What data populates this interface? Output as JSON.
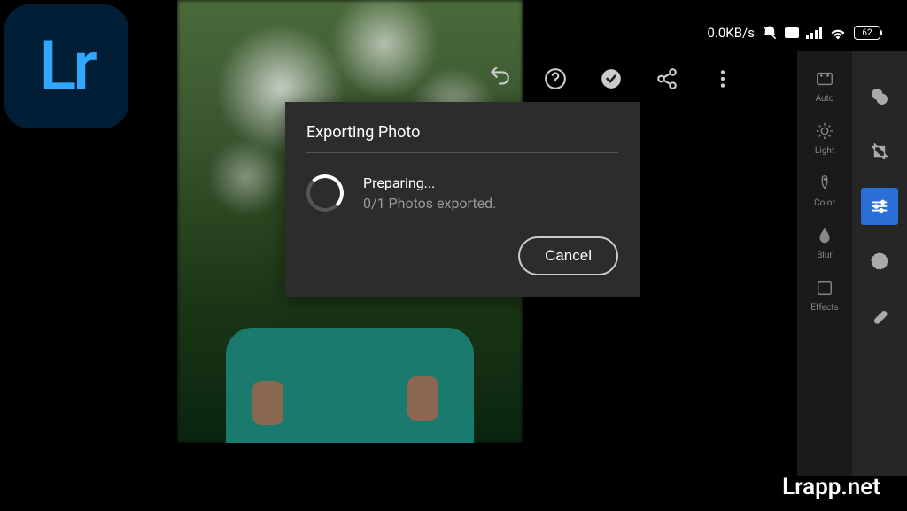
{
  "app_icon": "Lr",
  "status_bar": {
    "network_speed": "0.0KB/s",
    "battery": "62"
  },
  "toolbar": {
    "undo": "undo",
    "help": "help",
    "done": "done",
    "share": "share",
    "more": "more"
  },
  "modal": {
    "title": "Exporting Photo",
    "status": "Preparing...",
    "progress": "0/1 Photos exported.",
    "cancel_label": "Cancel"
  },
  "tool_panel_1": {
    "auto": "Auto",
    "light": "Light",
    "color": "Color",
    "blur": "Blur",
    "effects": "Effects"
  },
  "watermark": "Lrapp.net"
}
